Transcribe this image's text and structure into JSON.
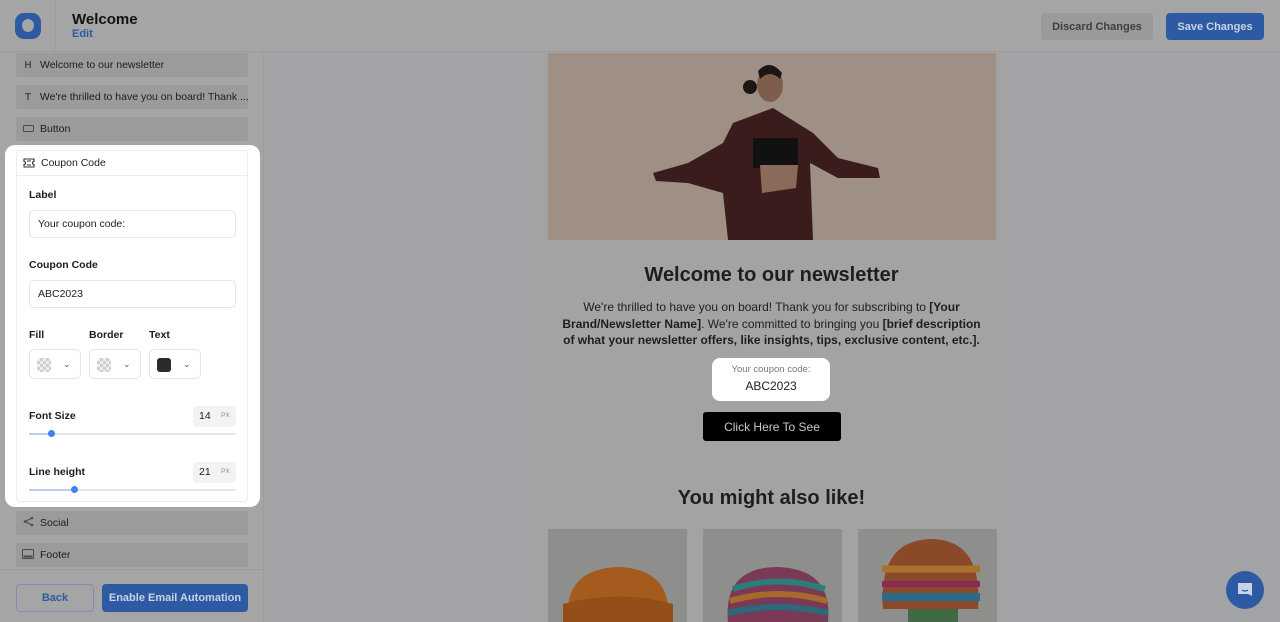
{
  "header": {
    "title": "Welcome",
    "edit_label": "Edit",
    "discard_label": "Discard Changes",
    "save_label": "Save Changes"
  },
  "sidebar": {
    "blocks_above": [
      {
        "icon": "heading-icon",
        "glyph": "H",
        "label": "Welcome to our newsletter"
      },
      {
        "icon": "text-icon",
        "glyph": "T",
        "label": "We're thrilled to have you on board! Thank ..."
      },
      {
        "icon": "button-icon",
        "glyph": "▭",
        "label": "Button"
      }
    ],
    "blocks_below": [
      {
        "icon": "share-icon",
        "glyph": "<",
        "label": "Social"
      },
      {
        "icon": "footer-icon",
        "glyph": "▭",
        "label": "Footer"
      }
    ],
    "back_label": "Back",
    "enable_label": "Enable Email Automation"
  },
  "coupon_panel": {
    "title": "Coupon Code",
    "label_field": {
      "label": "Label",
      "value": "Your coupon code:"
    },
    "code_field": {
      "label": "Coupon Code",
      "value": "ABC2023"
    },
    "colors": {
      "fill_label": "Fill",
      "border_label": "Border",
      "text_label": "Text",
      "text_color": "#2b2b2b"
    },
    "font_size": {
      "label": "Font Size",
      "value": "14",
      "unit": "PX",
      "slider_fraction": 0.11
    },
    "line_height": {
      "label": "Line height",
      "value": "21",
      "unit": "PX",
      "slider_fraction": 0.22
    }
  },
  "email": {
    "heading": "Welcome to our newsletter",
    "body_parts": [
      {
        "text": "We're thrilled to have you on board! Thank you for subscribing to ",
        "bold": false
      },
      {
        "text": "[Your Brand/Newsletter Name]",
        "bold": true
      },
      {
        "text": ". We're committed to bringing you ",
        "bold": false
      },
      {
        "text": "[brief description of what your newsletter offers, like insights, tips, exclusive content, etc.]",
        "bold": true
      },
      {
        "text": ".",
        "bold": true
      }
    ],
    "coupon_label": "Your coupon code:",
    "coupon_code": "ABC2023",
    "cta_label": "Click Here To See",
    "products_heading": "You might also like!"
  },
  "colors": {
    "brand": "#2d5aa3",
    "slider_thumb": "#3b82f6"
  }
}
